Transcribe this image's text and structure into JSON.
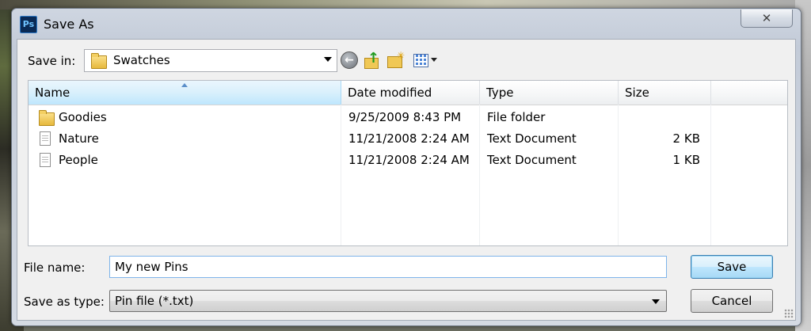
{
  "window": {
    "title": "Save As",
    "app_icon_text": "Ps",
    "close_symbol": "✕"
  },
  "toolbar": {
    "save_in_label": "Save in:",
    "save_in_value": "Swatches",
    "icons": [
      "back-icon",
      "up-folder-icon",
      "new-folder-icon",
      "views-menu-icon"
    ]
  },
  "list": {
    "columns": [
      "Name",
      "Date modified",
      "Type",
      "Size"
    ],
    "sorted_column": "Name",
    "rows": [
      {
        "name": "Goodies",
        "date": "9/25/2009 8:43 PM",
        "type": "File folder",
        "size": "",
        "icon": "folder-icon"
      },
      {
        "name": "Nature",
        "date": "11/21/2008 2:24 AM",
        "type": "Text Document",
        "size": "2 KB",
        "icon": "text-document-icon"
      },
      {
        "name": "People",
        "date": "11/21/2008 2:24 AM",
        "type": "Text Document",
        "size": "1 KB",
        "icon": "text-document-icon"
      }
    ]
  },
  "form": {
    "file_name_label": "File name:",
    "file_name_value": "My new Pins",
    "save_as_type_label": "Save as type:",
    "save_as_type_value": "Pin file (*.txt)"
  },
  "buttons": {
    "save": "Save",
    "cancel": "Cancel"
  }
}
